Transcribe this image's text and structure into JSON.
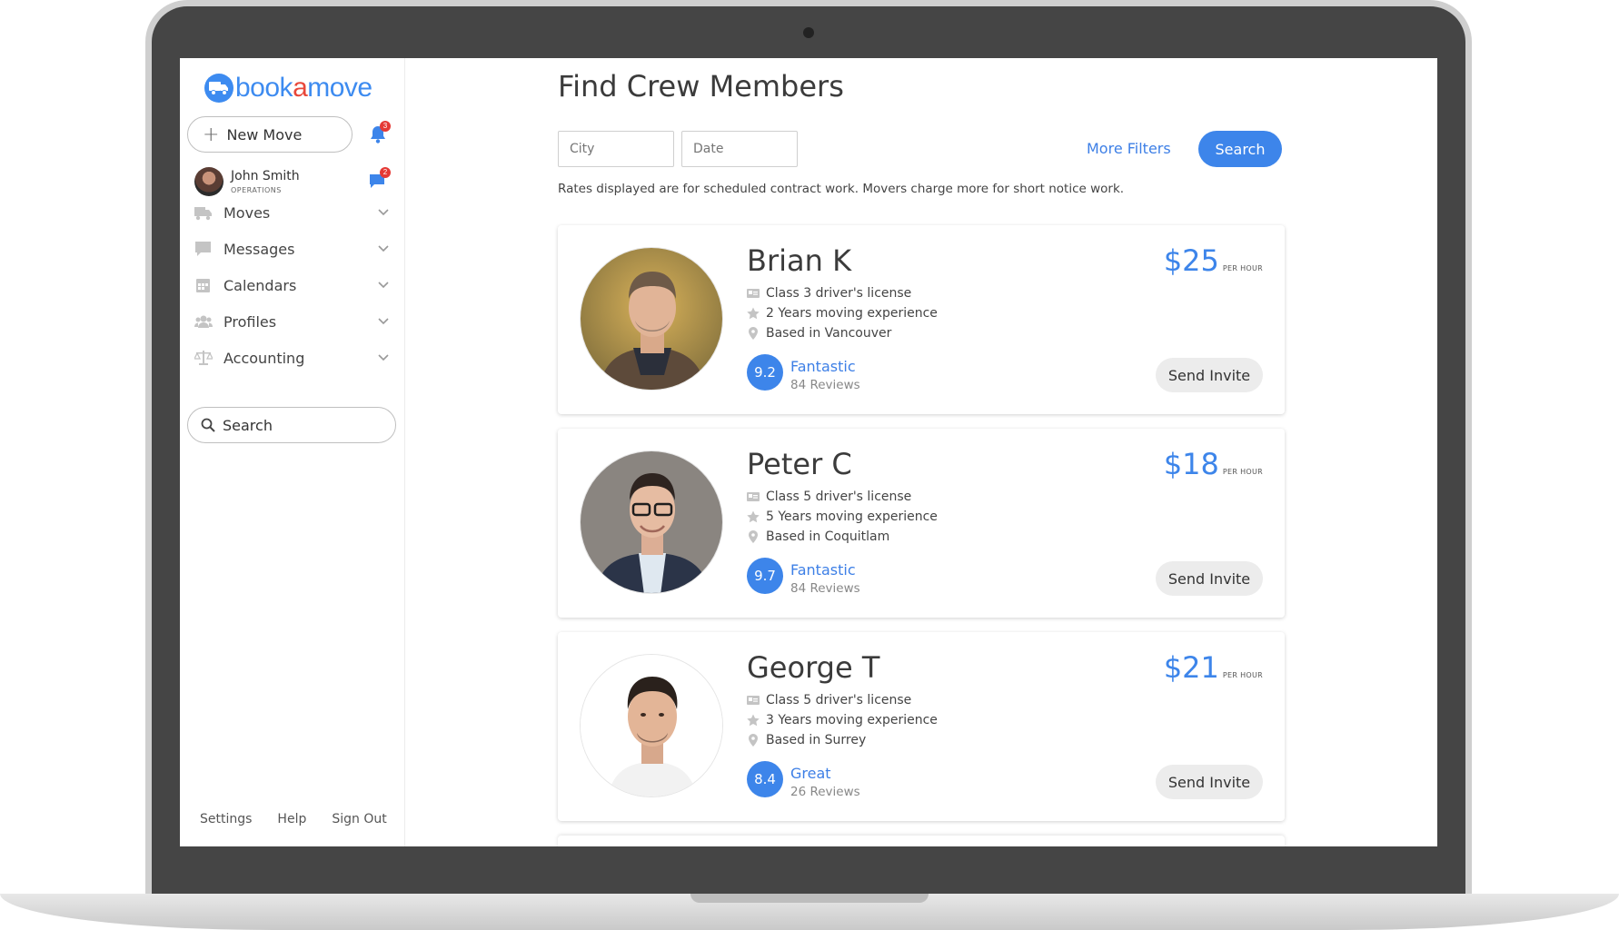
{
  "brand": {
    "part1": "book",
    "part2": "a",
    "part3": "move"
  },
  "sidebar": {
    "new_move_label": "New Move",
    "notifications_count": "3",
    "messages_count": "2",
    "user": {
      "name": "John Smith",
      "role": "OPERATIONS"
    },
    "items": [
      {
        "label": "Moves",
        "icon": "truck-icon"
      },
      {
        "label": "Messages",
        "icon": "message-icon"
      },
      {
        "label": "Calendars",
        "icon": "calendar-icon"
      },
      {
        "label": "Profiles",
        "icon": "users-icon"
      },
      {
        "label": "Accounting",
        "icon": "scale-icon"
      }
    ],
    "search_label": "Search",
    "footer": {
      "settings": "Settings",
      "help": "Help",
      "sign_out": "Sign Out"
    }
  },
  "main": {
    "title": "Find Crew Members",
    "city_placeholder": "City",
    "date_placeholder": "Date",
    "more_filters": "More Filters",
    "search_button": "Search",
    "note": "Rates displayed are for scheduled contract work. Movers charge more for short notice work.",
    "per_hour": "PER HOUR",
    "invite_label": "Send Invite",
    "crew": [
      {
        "name": "Brian K",
        "license": "Class 3 driver's license",
        "experience": "2 Years moving experience",
        "location": "Based in Vancouver",
        "score": "9.2",
        "rating": "Fantastic",
        "reviews": "84 Reviews",
        "price": "$25"
      },
      {
        "name": "Peter C",
        "license": "Class 5 driver's license",
        "experience": "5 Years moving experience",
        "location": "Based in Coquitlam",
        "score": "9.7",
        "rating": "Fantastic",
        "reviews": "84 Reviews",
        "price": "$18"
      },
      {
        "name": "George T",
        "license": "Class 5 driver's license",
        "experience": "3 Years moving experience",
        "location": "Based in Surrey",
        "score": "8.4",
        "rating": "Great",
        "reviews": "26 Reviews",
        "price": "$21"
      }
    ]
  },
  "colors": {
    "accent": "#3d85ea",
    "brand_red": "#e8473a",
    "badge": "#e53935"
  }
}
